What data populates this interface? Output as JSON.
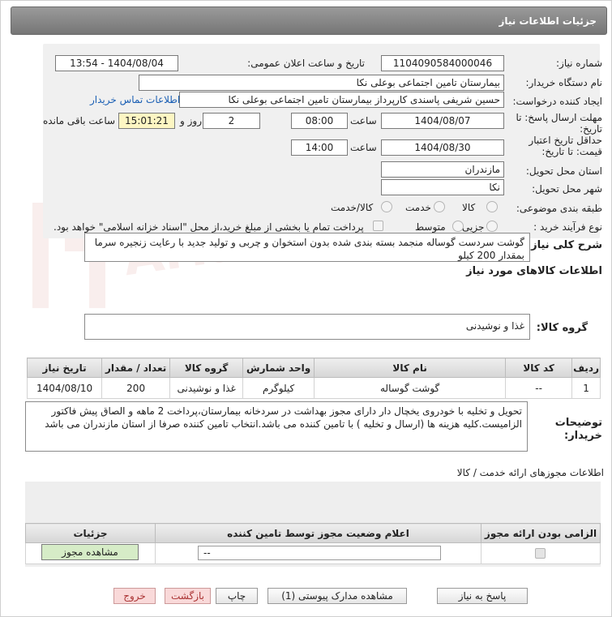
{
  "header": {
    "title": "جزئیات اطلاعات نیاز"
  },
  "fields": {
    "need_number_label": "شماره نیاز:",
    "need_number": "1104090584000046",
    "announce_label": "تاریخ و ساعت اعلان عمومی:",
    "announce_value": "1404/08/04 - 13:54",
    "buyer_org_label": "نام دستگاه خریدار:",
    "buyer_org": "بیمارستان تامین اجتماعی بوعلی نکا",
    "creator_label": "ایجاد کننده درخواست:",
    "creator": "حسین شریفی پاسندی کارپرداز بیمارستان تامین اجتماعی بوعلی نکا",
    "contact_link": "اطلاعات تماس خریدار",
    "deadline_label": "مهلت ارسال پاسخ: تا تاریخ:",
    "deadline_date": "1404/08/07",
    "time_label": "ساعت",
    "deadline_time": "08:00",
    "days_value": "2",
    "days_label": "روز و",
    "remaining_time": "15:01:21",
    "remaining_label": "ساعت باقی مانده",
    "validity_label": "حداقل تاریخ اعتبار قیمت: تا تاریخ:",
    "validity_date": "1404/08/30",
    "validity_time": "14:00",
    "province_label": "استان محل تحویل:",
    "province": "مازندران",
    "city_label": "شهر محل تحویل:",
    "city": "نکا",
    "category_label": "طبقه بندی موضوعی:",
    "category_options": [
      "کالا",
      "خدمت",
      "کالا/خدمت"
    ],
    "process_label": "نوع فرآیند خرید :",
    "process_options": [
      "جزیی",
      "متوسط"
    ],
    "treasury_note": "پرداخت تمام یا بخشی از مبلغ خرید،از محل \"اسناد خزانه اسلامی\" خواهد بود."
  },
  "description": {
    "label": "شرح کلی نیاز:",
    "text": "گوشت سردست گوساله منجمد بسته بندی شده بدون استخوان و چربی و تولید جدید با رعایت زنجیره سرما بمقدار 200 کیلو"
  },
  "goods_info": {
    "title": "اطلاعات کالاهای مورد نیاز",
    "group_label": "گروه کالا:",
    "group_value": "غذا و نوشیدنی",
    "table_headers": [
      "ردیف",
      "کد کالا",
      "نام کالا",
      "واحد شمارش",
      "گروه کالا",
      "تعداد / مقدار",
      "تاریخ نیاز"
    ],
    "rows": [
      [
        "1",
        "--",
        "گوشت گوساله",
        "کیلوگرم",
        "غذا و نوشیدنی",
        "200",
        "1404/08/10"
      ]
    ]
  },
  "buyer_notes": {
    "label": "توضیحات خریدار:",
    "text": "تحویل و تخلیه  با خودروی یخچال دار دارای مجوز بهداشت در سردخانه بیمارستان،پرداخت 2 ماهه و الصاق پیش فاکتور الزامیست.کلیه هزینه ها (ارسال و تخلیه ) با تامین کننده می باشد.انتخاب تامین کننده صرفا از استان مازندران می باشد"
  },
  "permits": {
    "title": "اطلاعات مجوزهای ارائه خدمت / کالا",
    "headers": [
      "الزامی بودن ارائه مجوز",
      "اعلام وضعیت مجوز توسط تامین کننده",
      "جزئیات"
    ],
    "status_select": "--",
    "view_button": "مشاهده مجوز"
  },
  "buttons": {
    "reply": "پاسخ به نیاز",
    "docs": "مشاهده مدارک پیوستی (1)",
    "print": "چاپ",
    "back": "بازگشت",
    "exit": "خروج"
  },
  "watermark": {
    "text": "AriaTender.net"
  },
  "colors": {
    "title_bar": "#8a8a8a",
    "link": "#1a5fb4",
    "highlight": "#fdf6c3",
    "pink_button": "#f9d9d9"
  }
}
